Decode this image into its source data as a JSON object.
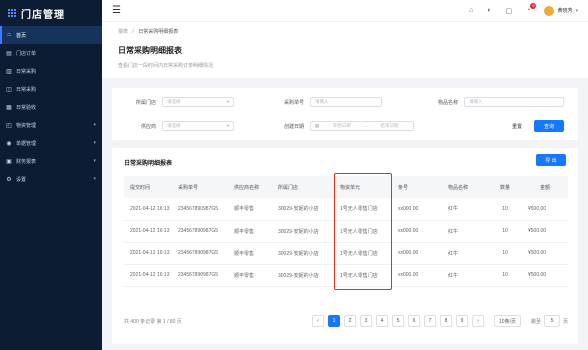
{
  "sidebar": {
    "app_title": "门店管理",
    "items": [
      {
        "label": "首页",
        "icon": "home-icon",
        "glyph": "⌂",
        "active": true
      },
      {
        "label": "门店订单",
        "icon": "order-icon",
        "glyph": "▤",
        "active": false
      },
      {
        "label": "日常采购",
        "icon": "purchase-icon",
        "glyph": "▥",
        "active": false
      },
      {
        "label": "日常采购",
        "icon": "cart-icon",
        "glyph": "◫",
        "active": false
      },
      {
        "label": "日常验收",
        "icon": "check-icon",
        "glyph": "▦",
        "active": false
      },
      {
        "label": "物资管理",
        "icon": "goods-icon",
        "glyph": "◰",
        "active": false,
        "has_arrow": true
      },
      {
        "label": "单据管理",
        "icon": "doc-icon",
        "glyph": "◉",
        "active": false,
        "has_arrow": true
      },
      {
        "label": "财务报表",
        "icon": "report-icon",
        "glyph": "▣",
        "active": false,
        "has_arrow": true
      },
      {
        "label": "设置",
        "icon": "settings-icon",
        "glyph": "⚙",
        "active": false,
        "has_arrow": true
      }
    ]
  },
  "topbar": {
    "menu_icon": "☰",
    "notification_count": "9",
    "user_name": "黄晓芳"
  },
  "header": {
    "breadcrumb_home": "报表",
    "breadcrumb_sep": "/",
    "breadcrumb_current": "日常采购明细报表",
    "title": "日常采购明细报表",
    "description": "查看门店一段时间内日常采购订单明细情况"
  },
  "filter": {
    "store_label": "所属门店",
    "store_placeholder": "请选择",
    "order_label": "采购单号",
    "order_placeholder": "请输入",
    "goods_label": "物品名称",
    "goods_placeholder": "请输入",
    "supplier_label": "供应商",
    "supplier_placeholder": "请选择",
    "date_label": "创建日期",
    "date_start": "开始日期",
    "date_sep": "~",
    "date_end": "结束日期",
    "reset_label": "重置",
    "search_label": "查询"
  },
  "table": {
    "title": "日常采购明细报表",
    "export_label": "导 出",
    "columns": [
      "提交时间",
      "采购单号",
      "供应商名称",
      "所属门店",
      "物资单元",
      "条号",
      "物品名称",
      "数量",
      "金额"
    ],
    "rows": [
      {
        "time": "2021-04-12 16:13",
        "order": "234567890987G5",
        "supplier": "顺丰零售",
        "store": "30029-安妮的小店",
        "unit": "1号无人零售门店",
        "code": "xx000.00",
        "goods": "红牛",
        "qty": "10",
        "amount": "¥500.00"
      },
      {
        "time": "2021-04-12 16:13",
        "order": "234567890987G5",
        "supplier": "顺丰零售",
        "store": "30029-安妮的小店",
        "unit": "1号无人零售门店",
        "code": "xx000.00",
        "goods": "红牛",
        "qty": "10",
        "amount": "¥500.00"
      },
      {
        "time": "2021-04-12 16:13",
        "order": "234567890987G5",
        "supplier": "顺丰零售",
        "store": "30029-安妮的小店",
        "unit": "1号无人零售门店",
        "code": "xx000.00",
        "goods": "红牛",
        "qty": "10",
        "amount": "¥500.00"
      },
      {
        "time": "2021-04-12 16:13",
        "order": "234567890987G5",
        "supplier": "顺丰零售",
        "store": "30029-安妮的小店",
        "unit": "1号无人零售门店",
        "code": "xx000.00",
        "goods": "红牛",
        "qty": "10",
        "amount": "¥500.00"
      }
    ]
  },
  "pagination": {
    "summary": "共 400 条记录 第 1 / 80 页",
    "prev": "‹",
    "pages": [
      "1",
      "2",
      "3",
      "4",
      "5",
      "6",
      "7",
      "8",
      "9"
    ],
    "next": "›",
    "page_size": "10条/页",
    "jump_label": "跳至",
    "jump_value": "5",
    "page_unit": "页"
  },
  "colors": {
    "primary": "#1677ff",
    "sidebar_bg": "#0c1c33",
    "highlight": "#e0301e"
  }
}
